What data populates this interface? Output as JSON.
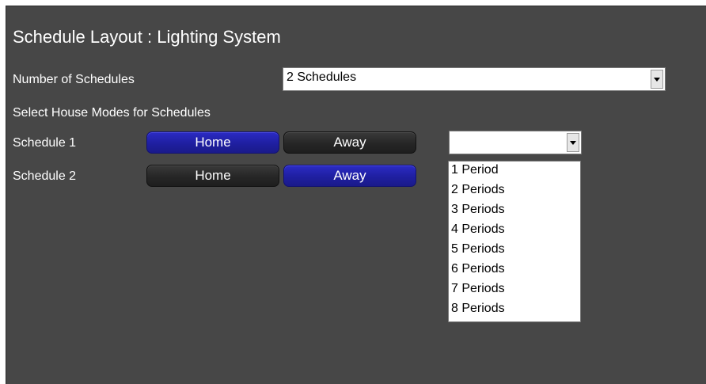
{
  "header": {
    "title": "Schedule Layout : Lighting System"
  },
  "schedules": {
    "label": "Number of Schedules",
    "selected": "2 Schedules"
  },
  "house_modes": {
    "label": "Select House Modes for Schedules"
  },
  "rows": [
    {
      "label": "Schedule 1",
      "home": "Home",
      "away": "Away",
      "active": "Home"
    },
    {
      "label": "Schedule 2",
      "home": "Home",
      "away": "Away",
      "active": "Away"
    }
  ],
  "period_select": {
    "selected": "",
    "options": [
      "1 Period",
      "2 Periods",
      "3 Periods",
      "4 Periods",
      "5 Periods",
      "6 Periods",
      "7 Periods",
      "8 Periods"
    ]
  },
  "colors": {
    "panel_bg": "#474747",
    "active_button": "#1f1fa0",
    "inactive_button": "#262626"
  }
}
